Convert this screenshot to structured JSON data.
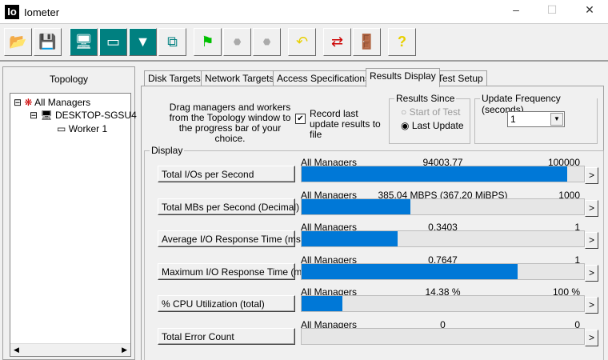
{
  "window": {
    "logo": "Io",
    "title": "Iometer"
  },
  "toolbar": [
    "open-icon",
    "save-icon",
    "start-manager-icon",
    "start-worker-icon",
    "network-worker-icon",
    "duplicate-worker-icon",
    "start-flag-icon",
    "stop-icon",
    "stop-all-icon",
    "reset-icon",
    "disconnect-icon",
    "exit-icon",
    "help-icon"
  ],
  "topology": {
    "title": "Topology",
    "items": [
      "All Managers",
      "DESKTOP-SGSU4",
      "Worker 1"
    ]
  },
  "tabs": [
    "Disk Targets",
    "Network Targets",
    "Access Specifications",
    "Results Display",
    "Test Setup"
  ],
  "instructions": "Drag managers and workers from the Topology window to the progress bar of your choice.",
  "record": {
    "label": "Record last update results to file",
    "checked": true
  },
  "results_since": {
    "title": "Results Since",
    "options": [
      "Start of Test",
      "Last Update"
    ],
    "selected": "Last Update"
  },
  "update_frequency": {
    "title": "Update Frequency (seconds)",
    "value": "1"
  },
  "display": {
    "title": "Display",
    "rows": [
      {
        "button": "Total I/Os per Second",
        "source": "All Managers",
        "value": "94003.77",
        "max": "100000",
        "fraction": 0.94
      },
      {
        "button": "Total MBs per Second (Decimal)",
        "source": "All Managers",
        "value": "385.04 MBPS (367.20 MiBPS)",
        "max": "1000",
        "fraction": 0.385
      },
      {
        "button": "Average I/O Response Time (ms)",
        "source": "All Managers",
        "value": "0.3403",
        "max": "1",
        "fraction": 0.34
      },
      {
        "button": "Maximum I/O Response Time (ms)",
        "source": "All Managers",
        "value": "0.7647",
        "max": "1",
        "fraction": 0.765
      },
      {
        "button": "% CPU Utilization (total)",
        "source": "All Managers",
        "value": "14.38 %",
        "max": "100 %",
        "fraction": 0.144
      },
      {
        "button": "Total Error Count",
        "source": "All Managers",
        "value": "0",
        "max": "0",
        "fraction": 0
      }
    ],
    "arrow": ">"
  }
}
